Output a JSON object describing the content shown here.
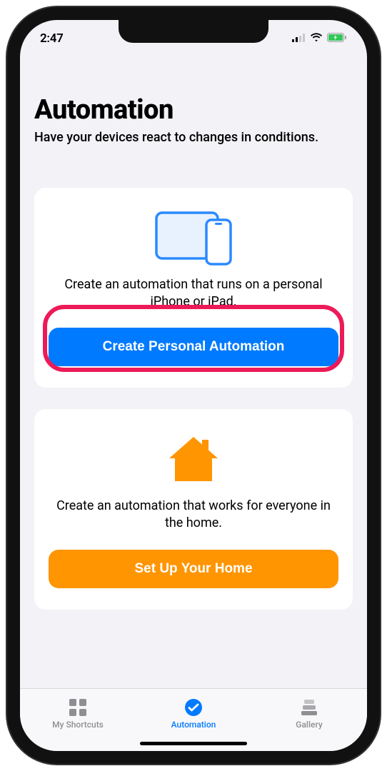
{
  "statusBar": {
    "time": "2:47"
  },
  "header": {
    "title": "Automation",
    "subtitle": "Have your devices react to changes in conditions."
  },
  "cards": {
    "personal": {
      "description": "Create an automation that runs on a personal iPhone or iPad.",
      "buttonLabel": "Create Personal Automation"
    },
    "home": {
      "description": "Create an automation that works for everyone in the home.",
      "buttonLabel": "Set Up Your Home"
    }
  },
  "tabs": {
    "shortcuts": "My Shortcuts",
    "automation": "Automation",
    "gallery": "Gallery"
  },
  "colors": {
    "blue": "#007aff",
    "orange": "#ff9500",
    "highlight": "#ed1a58"
  }
}
